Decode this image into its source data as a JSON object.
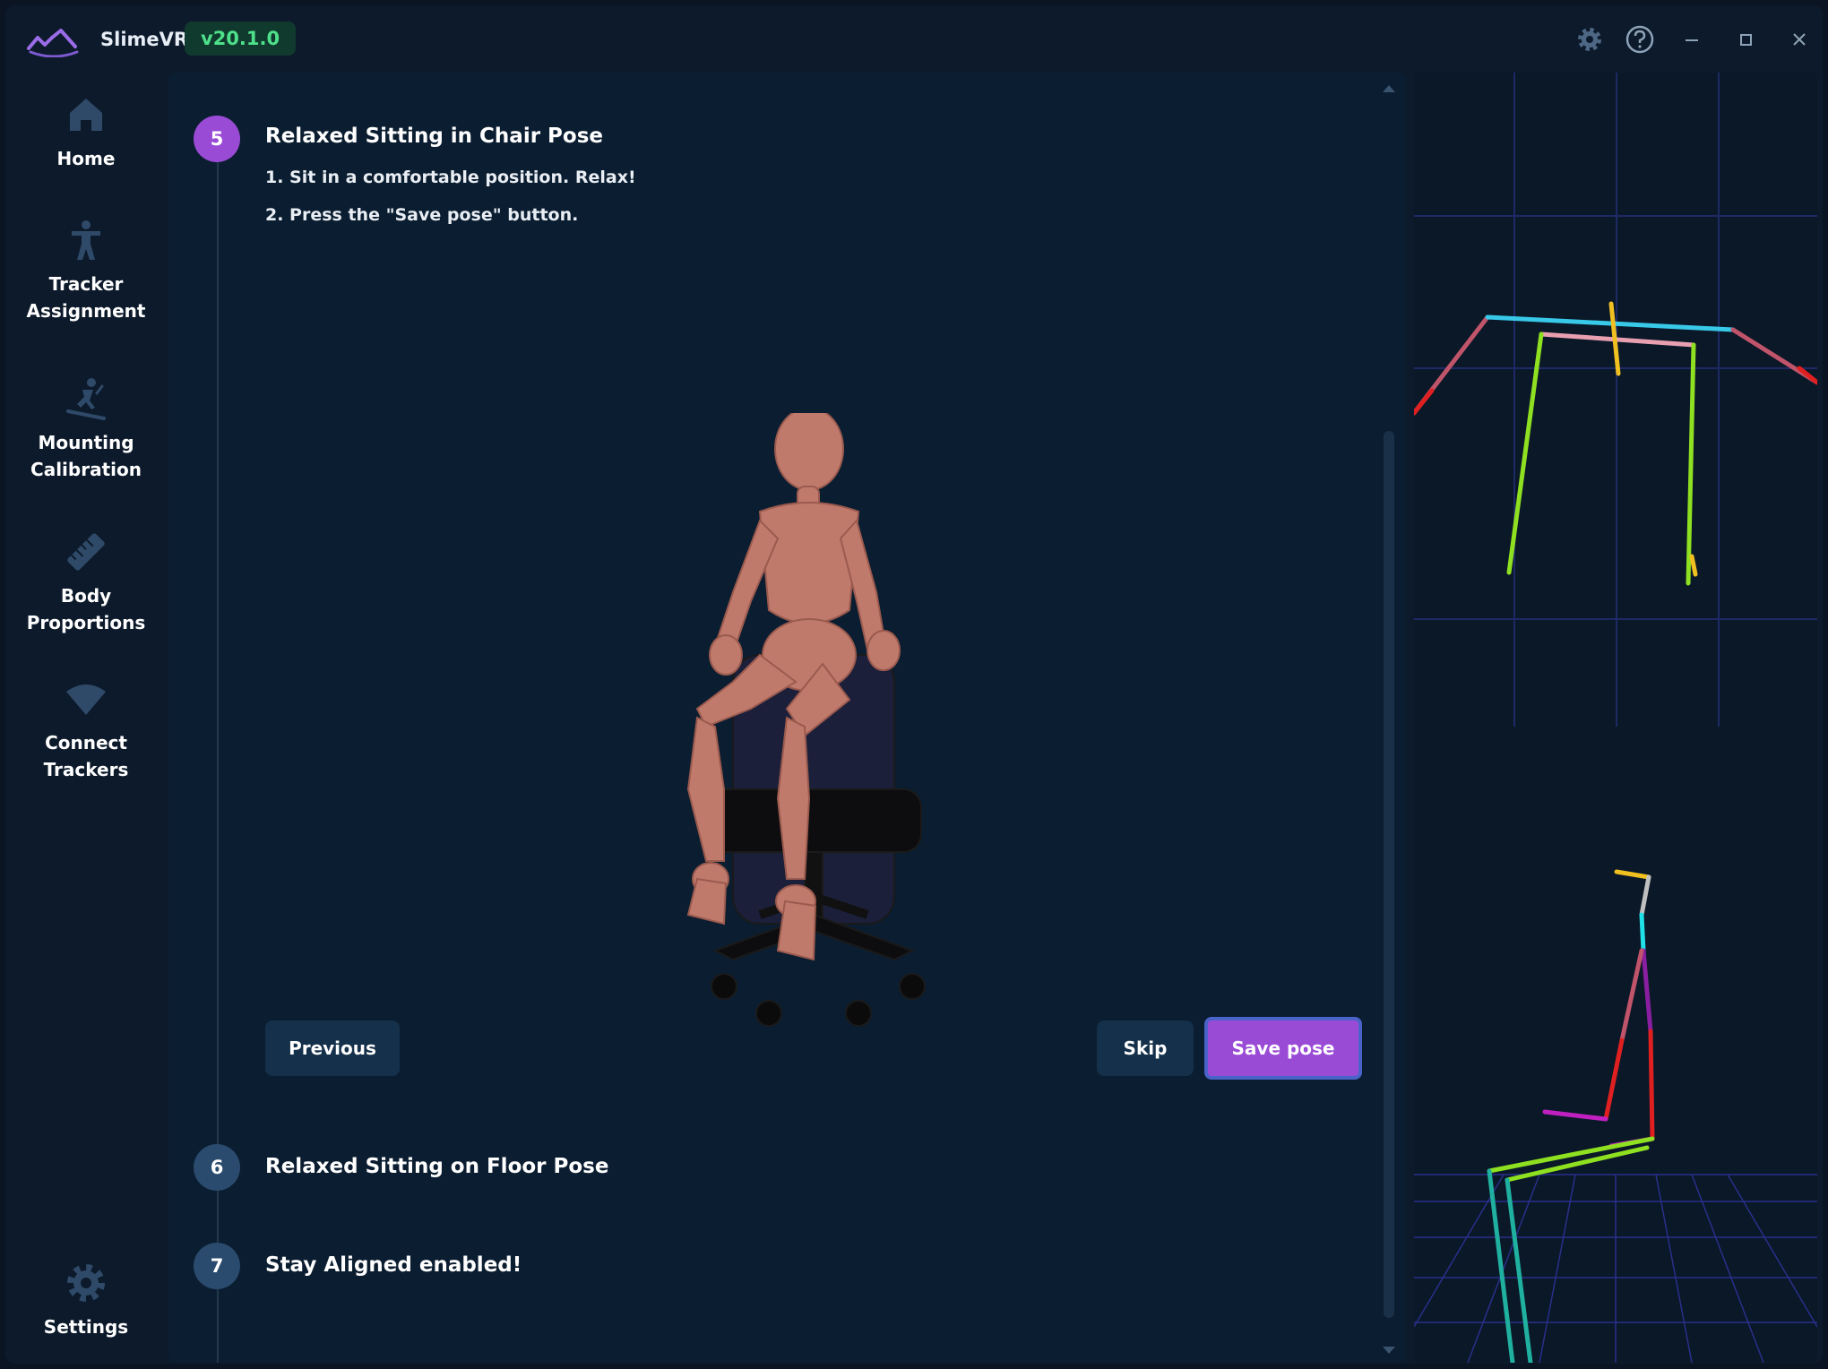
{
  "app": {
    "title": "SlimeVR",
    "version": "v20.1.0"
  },
  "sidebar": {
    "items": [
      {
        "label_line1": "Home",
        "label_line2": "",
        "icon": "home-icon"
      },
      {
        "label_line1": "Tracker",
        "label_line2": "Assignment",
        "icon": "person-icon"
      },
      {
        "label_line1": "Mounting",
        "label_line2": "Calibration",
        "icon": "ski-icon"
      },
      {
        "label_line1": "Body",
        "label_line2": "Proportions",
        "icon": "ruler-icon"
      },
      {
        "label_line1": "Connect",
        "label_line2": "Trackers",
        "icon": "wifi-icon"
      }
    ],
    "settings_label": "Settings"
  },
  "steps": {
    "current": {
      "number": "5",
      "title": "Relaxed Sitting in Chair Pose",
      "instructions": [
        "1. Sit in a comfortable position. Relax!",
        "2. Press the \"Save pose\" button."
      ]
    },
    "next": [
      {
        "number": "6",
        "title": "Relaxed Sitting on Floor Pose"
      },
      {
        "number": "7",
        "title": "Stay Aligned enabled!"
      }
    ]
  },
  "buttons": {
    "previous": "Previous",
    "skip": "Skip",
    "save": "Save pose"
  },
  "colors": {
    "accent": "#9a4bd6",
    "version_badge_bg": "#103a2e",
    "version_badge_text": "#4ee08a",
    "panel_bg": "#0b1d30"
  }
}
